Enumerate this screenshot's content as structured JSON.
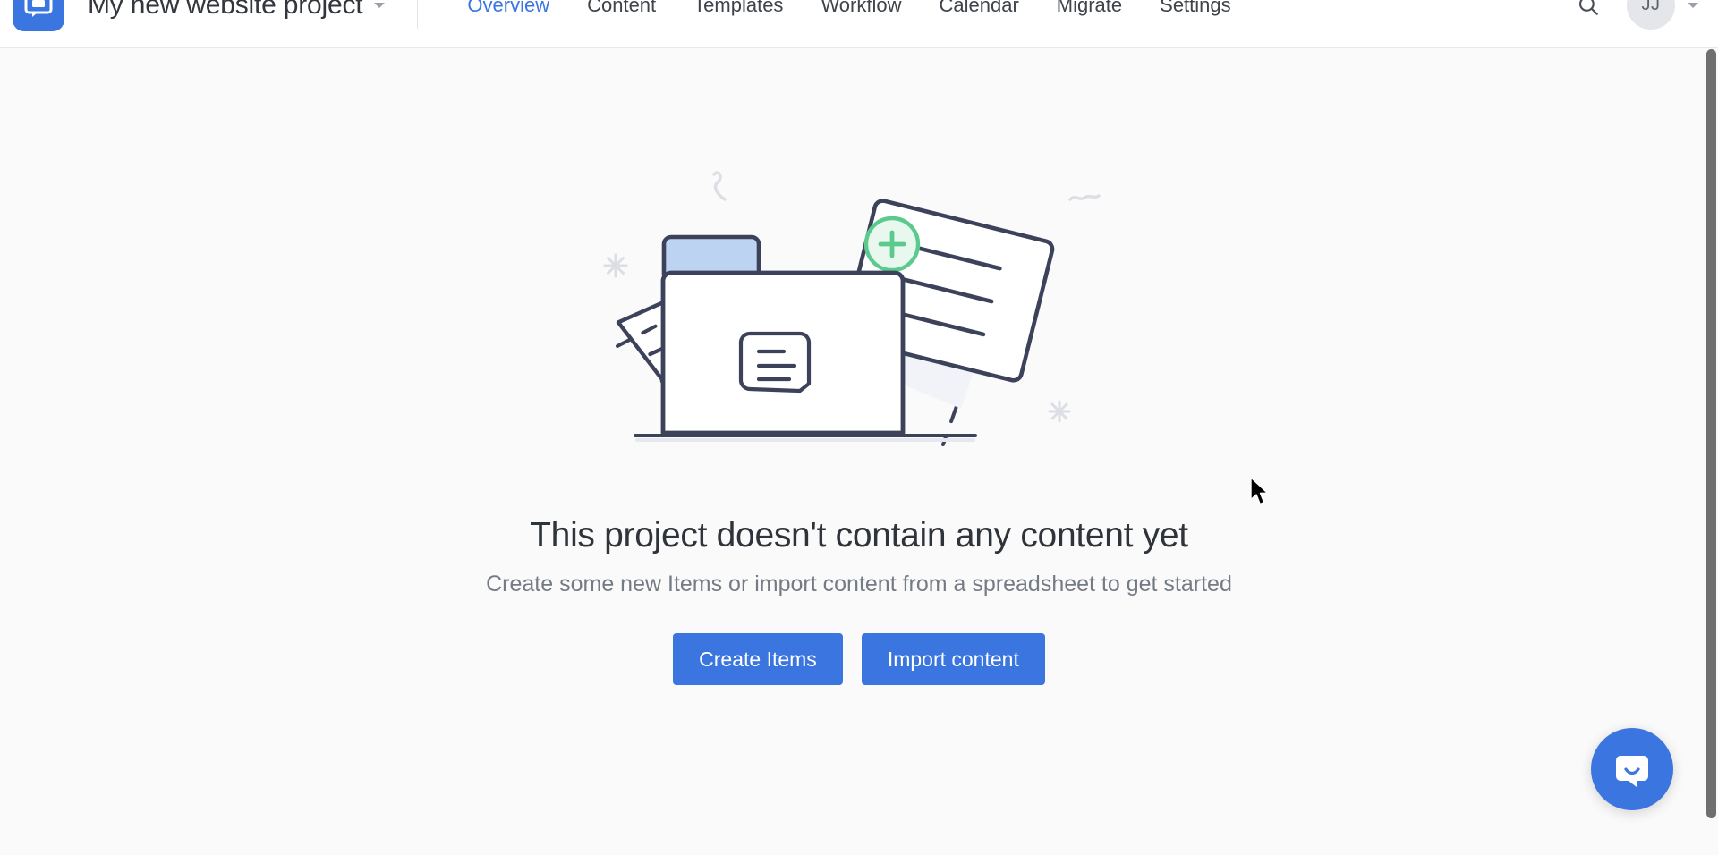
{
  "header": {
    "logo_icon": "app-logo-icon",
    "project_title": "My new website project",
    "project_caret_icon": "chevron-down-icon",
    "tabs": [
      {
        "label": "Overview",
        "active": true
      },
      {
        "label": "Content",
        "active": false
      },
      {
        "label": "Templates",
        "active": false
      },
      {
        "label": "Workflow",
        "active": false
      },
      {
        "label": "Calendar",
        "active": false
      },
      {
        "label": "Migrate",
        "active": false
      },
      {
        "label": "Settings",
        "active": false
      }
    ],
    "search_icon": "search-icon",
    "avatar_initials": "JJ",
    "avatar_caret_icon": "chevron-down-icon"
  },
  "empty_state": {
    "illustration": "empty-folder-illustration",
    "title": "This project doesn't contain any content yet",
    "subtitle": "Create some new Items or import content from a spreadsheet to get started",
    "primary_button": "Create Items",
    "secondary_button": "Import content"
  },
  "support": {
    "launcher_icon": "intercom-chat-icon"
  },
  "colors": {
    "brand_blue": "#3b76e0",
    "ink": "#3d425b",
    "accent_green": "#5cc98d",
    "page_bg": "#fafafa",
    "header_bg": "#ffffff"
  }
}
